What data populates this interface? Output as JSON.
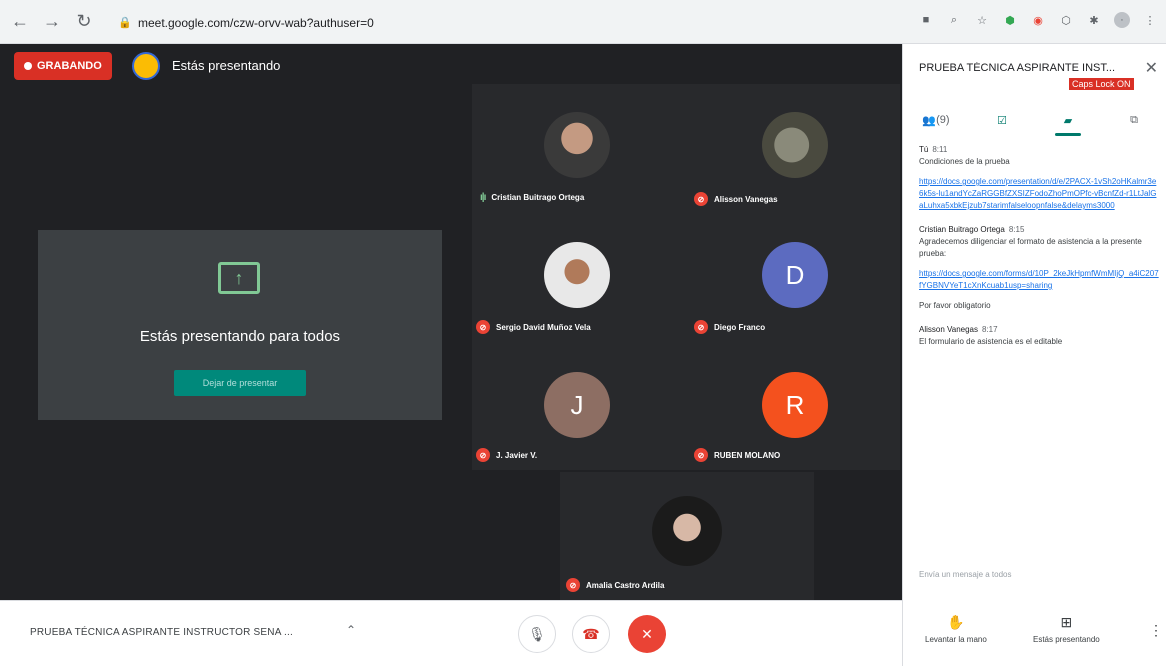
{
  "browser": {
    "url": "meet.google.com/czw-orvv-wab?authuser=0"
  },
  "stage": {
    "recording_label": "GRABANDO",
    "presenting_status": "Estás presentando",
    "present_card": {
      "title": "Estás presentando para todos",
      "stop_button": "Dejar de presentar"
    },
    "participants": [
      {
        "name": "Cristian Buitrago Ortega",
        "state": "speaking",
        "avatar_type": "photo"
      },
      {
        "name": "Alisson Vanegas",
        "state": "muted",
        "avatar_type": "photo"
      },
      {
        "name": "Sergio David Muñoz Vela",
        "state": "muted",
        "avatar_type": "photo"
      },
      {
        "name": "Diego Franco",
        "state": "muted",
        "avatar_type": "letter",
        "letter": "D",
        "color": "#5c6bc0"
      },
      {
        "name": "J. Javier V.",
        "state": "muted",
        "avatar_type": "letter",
        "letter": "J",
        "color": "#8d6e63"
      },
      {
        "name": "RUBEN MOLANO",
        "state": "muted",
        "avatar_type": "letter",
        "letter": "R",
        "color": "#f4511e"
      },
      {
        "name": "Amalia Castro Ardila",
        "state": "muted",
        "avatar_type": "photo"
      }
    ]
  },
  "bottom_bar": {
    "meeting_title": "PRUEBA TÉCNICA ASPIRANTE INSTRUCTOR SENA ..."
  },
  "panel": {
    "title": "PRUEBA TÉCNICA ASPIRANTE INST...",
    "caps_lock": "Caps Lock ON",
    "people_tab": "(9)",
    "messages": [
      {
        "sender": "Tú",
        "time": "8:11",
        "lines": [
          "Condiciones de la prueba"
        ],
        "link": "https://docs.google.com/presentation/d/e/2PACX-1vSh2oHKalmr3e6k5s-lu1andYcZaRGGBfZXSIZFodoZhoPmOPfc-vBcnfZd-r1LtJalGaLuhxa5xbkEjzub7starimfalseloopnfalse&delayms3000"
      },
      {
        "sender": "Cristian Buitrago Ortega",
        "time": "8:15",
        "lines": [
          "Agradecemos diligenciar el formato de asistencia a la presente prueba:"
        ],
        "link": "https://docs.google.com/forms/d/10P_2keJkHpmfWmMIjQ_a4iC207fYGBNVYeT1cXnKcuab1usp=sharing",
        "after": "Por favor obligatorio"
      },
      {
        "sender": "Alisson Vanegas",
        "time": "8:17",
        "lines": [
          "El formulario de asistencia es el editable"
        ]
      }
    ],
    "input_placeholder": "Envía un mensaje a todos",
    "raise_hand_label": "Levantar la mano",
    "presenting_label": "Estás presentando"
  }
}
